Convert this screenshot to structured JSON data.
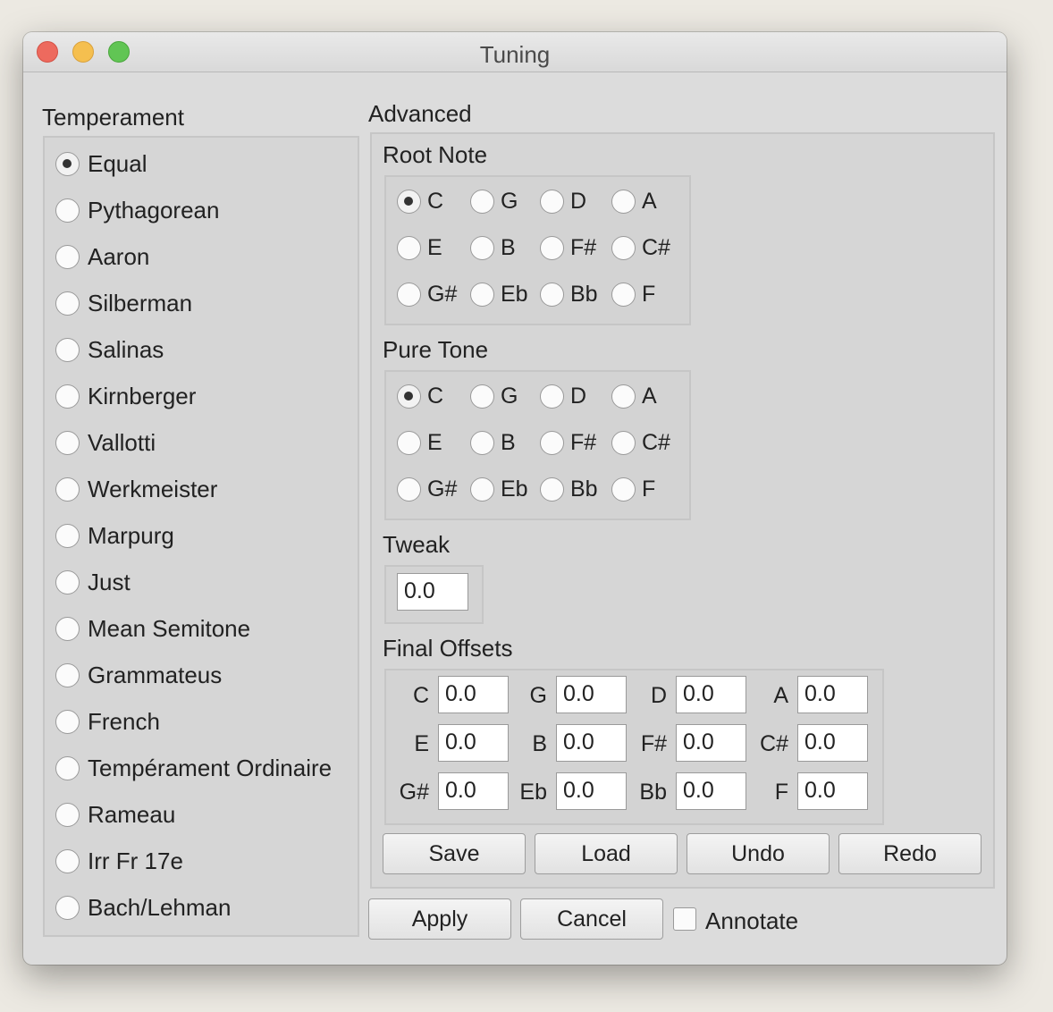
{
  "window": {
    "title": "Tuning"
  },
  "temperament": {
    "label": "Temperament",
    "options": [
      "Equal",
      "Pythagorean",
      "Aaron",
      "Silberman",
      "Salinas",
      "Kirnberger",
      "Vallotti",
      "Werkmeister",
      "Marpurg",
      "Just",
      "Mean Semitone",
      "Grammateus",
      "French",
      "Tempérament Ordinaire",
      "Rameau",
      "Irr Fr 17e",
      "Bach/Lehman"
    ],
    "selected": "Equal"
  },
  "advanced": {
    "label": "Advanced",
    "root_note": {
      "label": "Root Note",
      "notes": [
        "C",
        "G",
        "D",
        "A",
        "E",
        "B",
        "F#",
        "C#",
        "G#",
        "Eb",
        "Bb",
        "F"
      ],
      "selected": "C"
    },
    "pure_tone": {
      "label": "Pure Tone",
      "notes": [
        "C",
        "G",
        "D",
        "A",
        "E",
        "B",
        "F#",
        "C#",
        "G#",
        "Eb",
        "Bb",
        "F"
      ],
      "selected": "C"
    },
    "tweak": {
      "label": "Tweak",
      "value": "0.0"
    },
    "final_offsets": {
      "label": "Final Offsets",
      "entries": [
        {
          "note": "C",
          "value": "0.0"
        },
        {
          "note": "G",
          "value": "0.0"
        },
        {
          "note": "D",
          "value": "0.0"
        },
        {
          "note": "A",
          "value": "0.0"
        },
        {
          "note": "E",
          "value": "0.0"
        },
        {
          "note": "B",
          "value": "0.0"
        },
        {
          "note": "F#",
          "value": "0.0"
        },
        {
          "note": "C#",
          "value": "0.0"
        },
        {
          "note": "G#",
          "value": "0.0"
        },
        {
          "note": "Eb",
          "value": "0.0"
        },
        {
          "note": "Bb",
          "value": "0.0"
        },
        {
          "note": "F",
          "value": "0.0"
        }
      ]
    },
    "buttons": {
      "save": "Save",
      "load": "Load",
      "undo": "Undo",
      "redo": "Redo"
    }
  },
  "footer": {
    "apply": "Apply",
    "cancel": "Cancel",
    "annotate": "Annotate",
    "annotate_checked": false
  }
}
